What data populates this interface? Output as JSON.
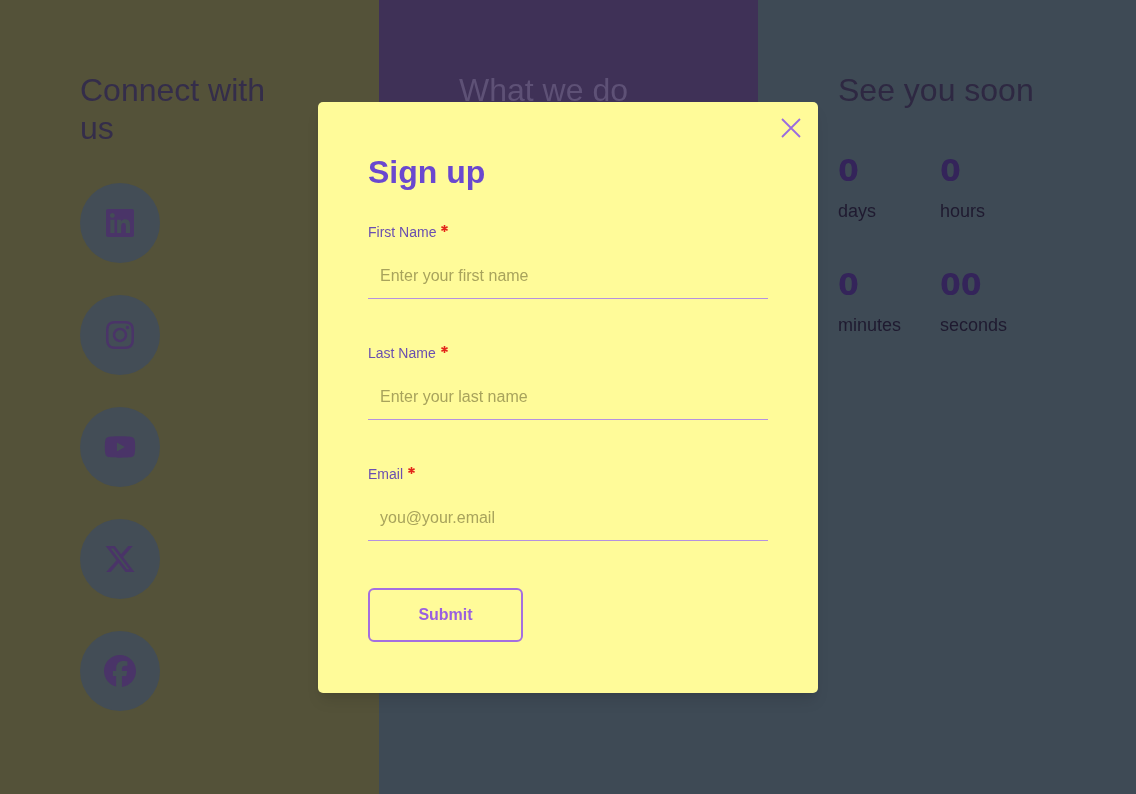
{
  "columns": [
    {
      "kind": "social",
      "heading": "Connect with us",
      "links": [
        {
          "kind": "linkedin"
        },
        {
          "kind": "instagram"
        },
        {
          "kind": "youtube"
        },
        {
          "kind": "x"
        },
        {
          "kind": "facebook"
        }
      ]
    },
    {
      "kind": "text",
      "heading": "What we do"
    },
    {
      "kind": "countdown",
      "heading": "See you soon",
      "units": [
        {
          "value": "0",
          "label": "days"
        },
        {
          "value": "0",
          "label": "hours"
        },
        {
          "value": "0",
          "label": "minutes"
        },
        {
          "value": "00",
          "label": "seconds"
        }
      ]
    }
  ],
  "modal": {
    "title": "Sign up",
    "fields": [
      {
        "label": "First Name",
        "required": true,
        "placeholder": "Enter your first name"
      },
      {
        "label": "Last Name",
        "required": true,
        "placeholder": "Enter your last name"
      },
      {
        "label": "Email",
        "required": true,
        "placeholder": "you@your.email"
      }
    ],
    "submit": "Submit"
  }
}
